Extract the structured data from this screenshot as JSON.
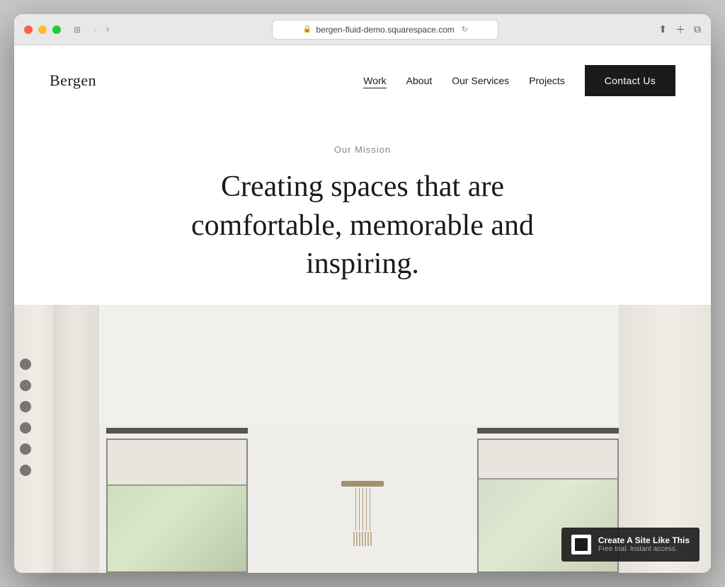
{
  "window": {
    "url": "bergen-fluid-demo.squarespace.com",
    "traffic_lights": [
      "close",
      "minimize",
      "maximize"
    ]
  },
  "site": {
    "logo": "Bergen",
    "nav": {
      "links": [
        {
          "label": "Work",
          "active": true
        },
        {
          "label": "About",
          "active": false
        },
        {
          "label": "Our Services",
          "active": false
        },
        {
          "label": "Projects",
          "active": false
        }
      ],
      "cta_label": "Contact Us"
    },
    "hero": {
      "section_label": "Our Mission",
      "headline_line1": "Creating spaces that are",
      "headline_line2": "comfortable, memorable and",
      "headline_line3": "inspiring."
    },
    "badge": {
      "title": "Create A Site Like This",
      "subtitle": "Free trial. Instant access."
    }
  }
}
